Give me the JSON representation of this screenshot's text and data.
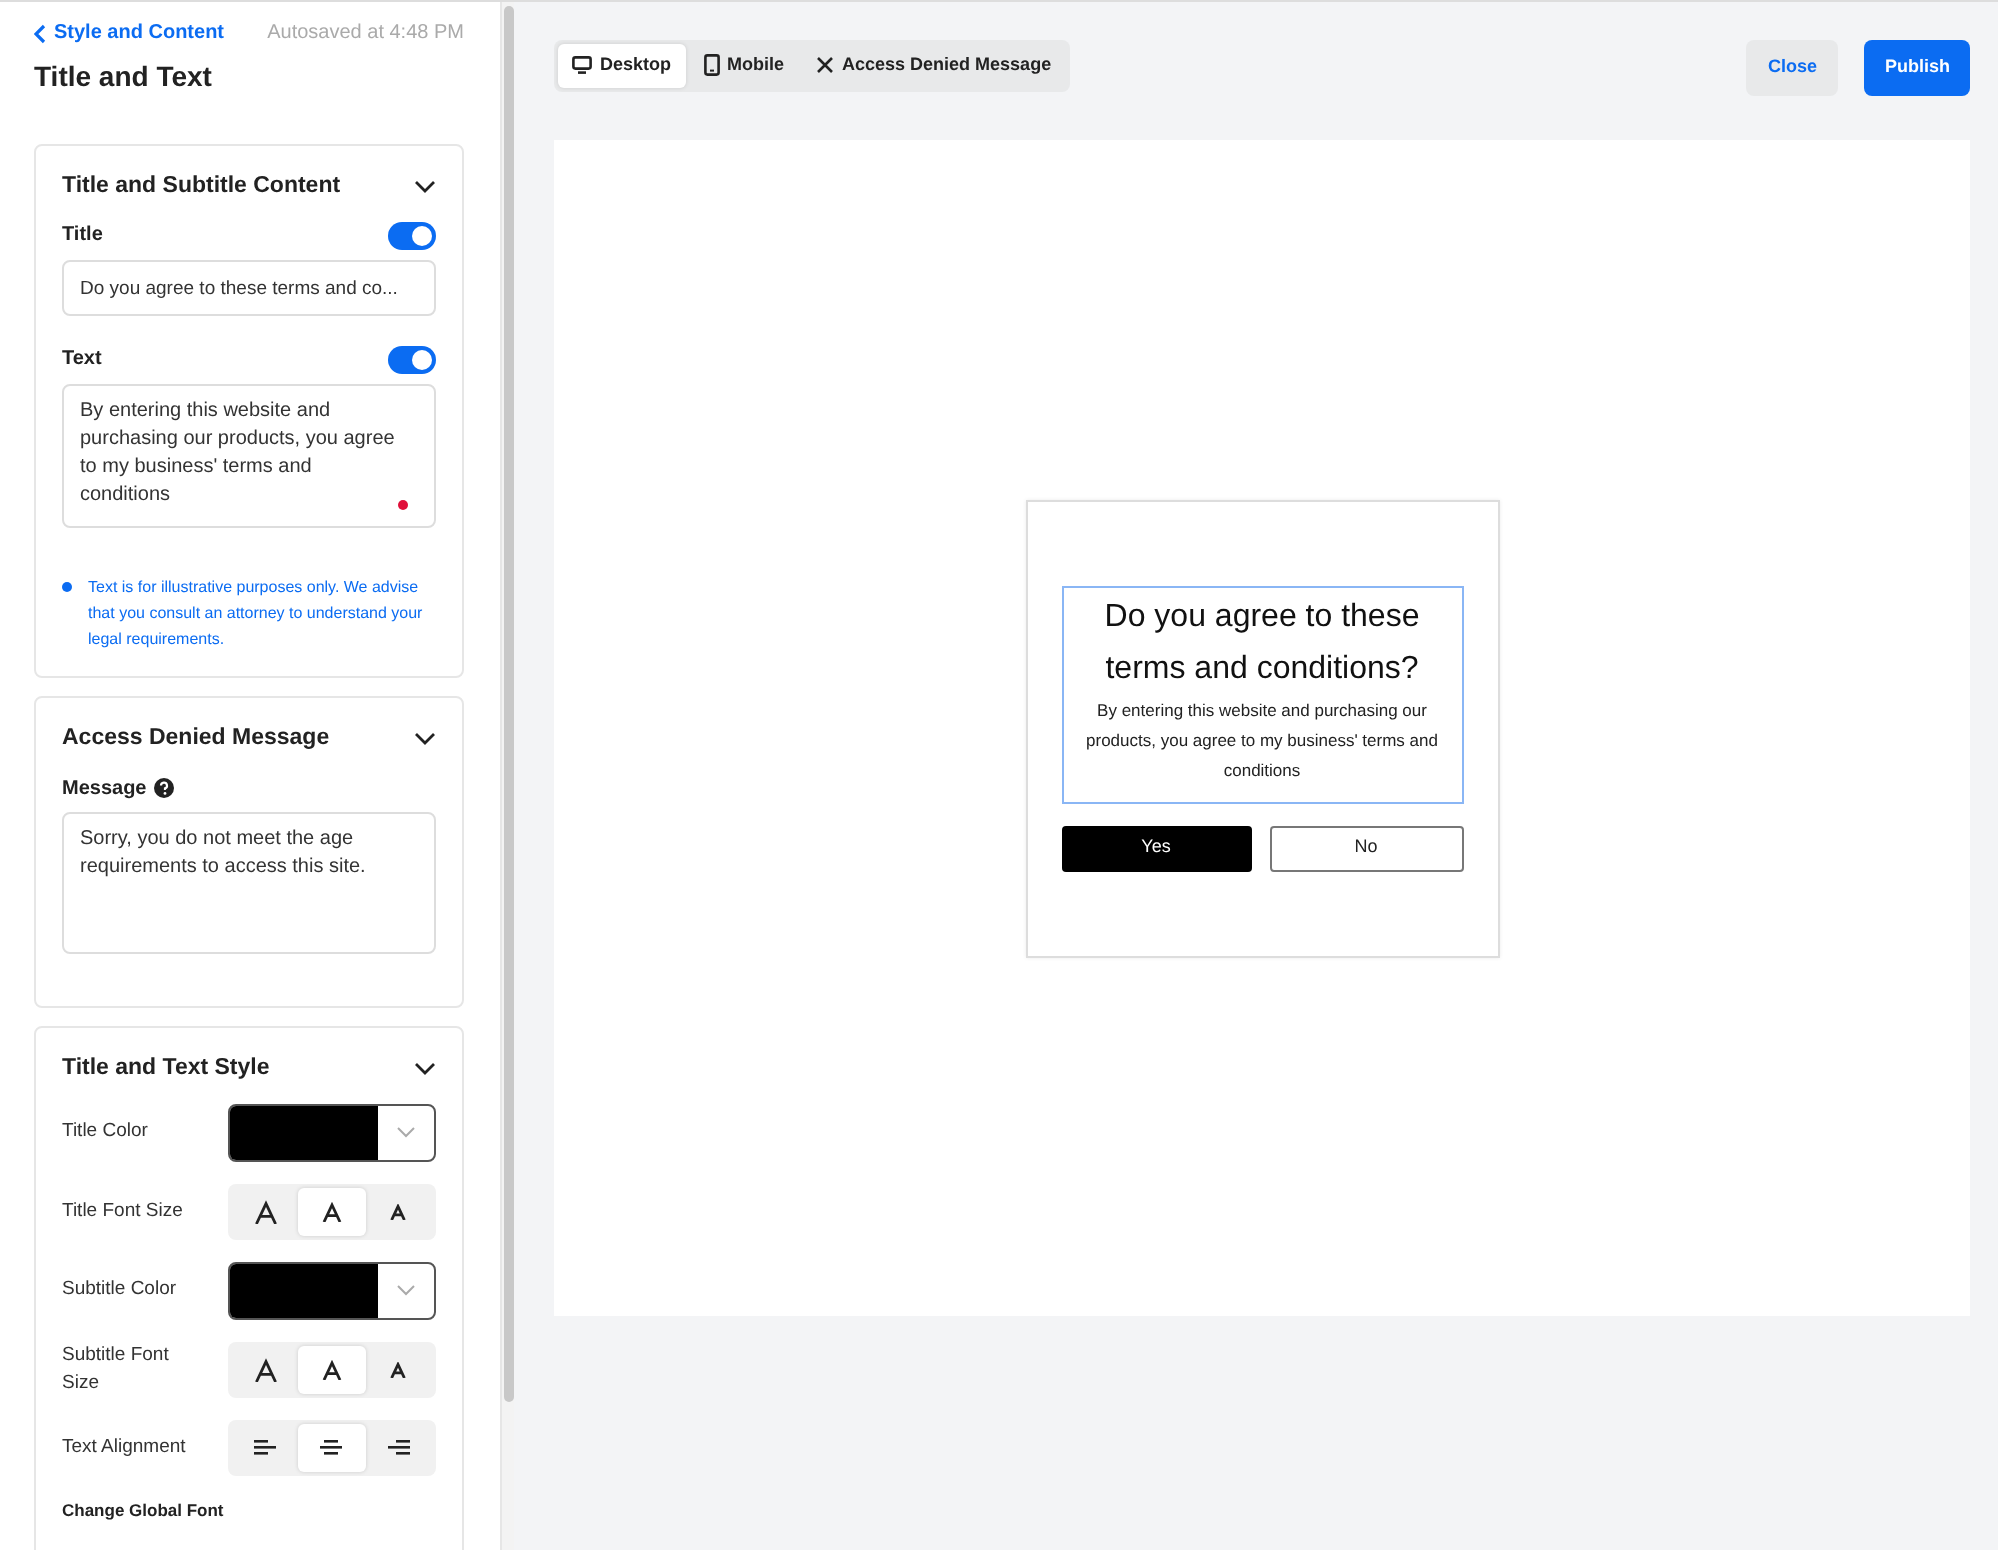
{
  "sidebar": {
    "back_link": "Style and Content",
    "autosave": "Autosaved at 4:48 PM",
    "title": "Title and Text"
  },
  "content_section": {
    "title": "Title and Subtitle Content",
    "fields": [
      {
        "kind": "input",
        "label": "Title",
        "on": true,
        "value": "Do you agree to these terms and co..."
      },
      {
        "kind": "textarea",
        "label": "Text",
        "on": true,
        "value": "By entering this website and purchasing our products, you agree to my business' terms and conditions"
      }
    ],
    "note": "Text is for illustrative purposes only. We advise that you consult an attorney to understand your legal requirements."
  },
  "denied_section": {
    "title": "Access Denied Message",
    "message_label": "Message",
    "message": "Sorry, you do not meet the age requirements to access this site."
  },
  "style_section": {
    "title": "Title and Text Style",
    "rows": [
      {
        "kind": "color",
        "label": "Title Color",
        "color": "#000000"
      },
      {
        "kind": "size",
        "label": "Title Font Size",
        "options": [
          {
            "selected": false
          },
          {
            "selected": true
          },
          {
            "selected": false
          }
        ]
      },
      {
        "kind": "color",
        "label": "Subtitle Color",
        "color": "#000000"
      },
      {
        "kind": "size",
        "label": "Subtitle Font Size",
        "options": [
          {
            "selected": false
          },
          {
            "selected": true
          },
          {
            "selected": false
          }
        ]
      },
      {
        "kind": "align",
        "label": "Text Alignment",
        "options": [
          {
            "selected": false
          },
          {
            "selected": true
          },
          {
            "selected": false
          }
        ]
      }
    ],
    "footer_label": "Change Global Font"
  },
  "toolbar": {
    "tabs": [
      {
        "kind": "desktop",
        "label": "Desktop",
        "selected": true
      },
      {
        "kind": "mobile",
        "label": "Mobile",
        "selected": false
      },
      {
        "kind": "denied",
        "label": "Access Denied Message",
        "selected": false
      }
    ],
    "close": "Close",
    "publish": "Publish"
  },
  "preview": {
    "title": "Do you agree to these terms and conditions?",
    "text": "By entering this website and purchasing our products, you agree to my business' terms and conditions",
    "yes": "Yes",
    "no": "No"
  }
}
